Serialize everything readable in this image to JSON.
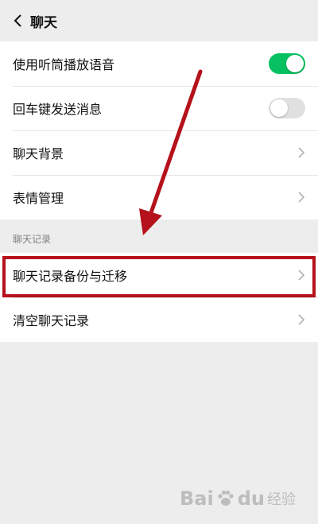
{
  "header": {
    "title": "聊天"
  },
  "settings_group": {
    "rows": [
      {
        "label": "使用听筒播放语音",
        "toggle": "on"
      },
      {
        "label": "回车键发送消息",
        "toggle": "off"
      },
      {
        "label": "聊天背景"
      },
      {
        "label": "表情管理"
      }
    ]
  },
  "history_section": {
    "title": "聊天记录",
    "rows": [
      {
        "label": "聊天记录备份与迁移",
        "highlighted": true
      },
      {
        "label": "清空聊天记录"
      }
    ]
  },
  "watermark": {
    "brand_a": "Bai",
    "brand_b": "du",
    "text": "经验"
  },
  "colors": {
    "toggle_on": "#07c160",
    "toggle_off": "#e0e0e0",
    "annotation_red": "#b5121b",
    "background": "#ededed"
  }
}
